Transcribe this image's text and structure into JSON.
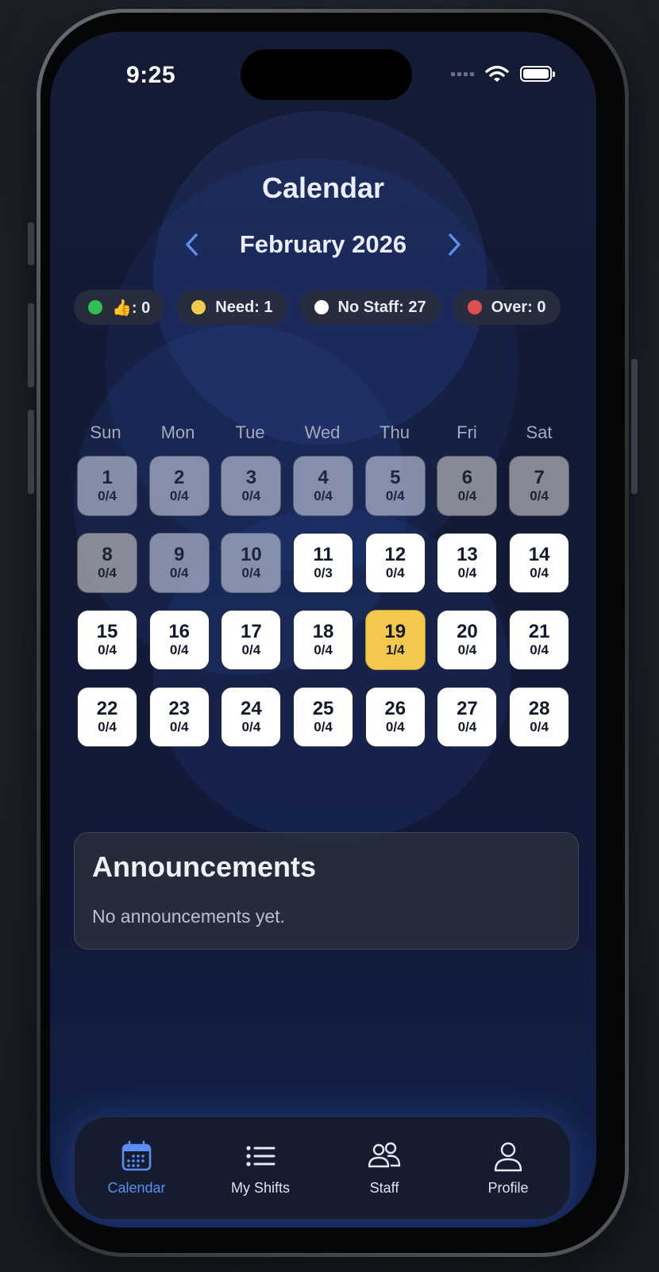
{
  "status_bar": {
    "time": "9:25"
  },
  "header": {
    "title": "Calendar",
    "month": "February 2026"
  },
  "legend": [
    {
      "label": "👍: 0",
      "color": "#2fbf55"
    },
    {
      "label": "Need: 1",
      "color": "#f2c94c"
    },
    {
      "label": "No Staff: 27",
      "color": "#ffffff"
    },
    {
      "label": "Over: 0",
      "color": "#e04e4e"
    }
  ],
  "weekdays": [
    "Sun",
    "Mon",
    "Tue",
    "Wed",
    "Thu",
    "Fri",
    "Sat"
  ],
  "days": [
    {
      "day": "1",
      "count": "0/4",
      "state": "past"
    },
    {
      "day": "2",
      "count": "0/4",
      "state": "past"
    },
    {
      "day": "3",
      "count": "0/4",
      "state": "past"
    },
    {
      "day": "4",
      "count": "0/4",
      "state": "past"
    },
    {
      "day": "5",
      "count": "0/4",
      "state": "past"
    },
    {
      "day": "6",
      "count": "0/4",
      "state": "pastdark"
    },
    {
      "day": "7",
      "count": "0/4",
      "state": "pastdark"
    },
    {
      "day": "8",
      "count": "0/4",
      "state": "pastdark"
    },
    {
      "day": "9",
      "count": "0/4",
      "state": "past"
    },
    {
      "day": "10",
      "count": "0/4",
      "state": "past"
    },
    {
      "day": "11",
      "count": "0/3",
      "state": "future"
    },
    {
      "day": "12",
      "count": "0/4",
      "state": "future"
    },
    {
      "day": "13",
      "count": "0/4",
      "state": "future"
    },
    {
      "day": "14",
      "count": "0/4",
      "state": "future"
    },
    {
      "day": "15",
      "count": "0/4",
      "state": "future"
    },
    {
      "day": "16",
      "count": "0/4",
      "state": "future"
    },
    {
      "day": "17",
      "count": "0/4",
      "state": "future"
    },
    {
      "day": "18",
      "count": "0/4",
      "state": "future"
    },
    {
      "day": "19",
      "count": "1/4",
      "state": "need"
    },
    {
      "day": "20",
      "count": "0/4",
      "state": "future"
    },
    {
      "day": "21",
      "count": "0/4",
      "state": "future"
    },
    {
      "day": "22",
      "count": "0/4",
      "state": "future"
    },
    {
      "day": "23",
      "count": "0/4",
      "state": "future"
    },
    {
      "day": "24",
      "count": "0/4",
      "state": "future"
    },
    {
      "day": "25",
      "count": "0/4",
      "state": "future"
    },
    {
      "day": "26",
      "count": "0/4",
      "state": "future"
    },
    {
      "day": "27",
      "count": "0/4",
      "state": "future"
    },
    {
      "day": "28",
      "count": "0/4",
      "state": "future"
    }
  ],
  "announcements": {
    "title": "Announcements",
    "empty_text": "No announcements yet."
  },
  "tabs": [
    {
      "label": "Calendar",
      "icon": "calendar-icon",
      "active": true
    },
    {
      "label": "My Shifts",
      "icon": "list-icon",
      "active": false
    },
    {
      "label": "Staff",
      "icon": "users-icon",
      "active": false
    },
    {
      "label": "Profile",
      "icon": "person-icon",
      "active": false
    }
  ],
  "colors": {
    "accent": "#5b8ef0",
    "need": "#f2c94c",
    "background": "#121a36"
  }
}
